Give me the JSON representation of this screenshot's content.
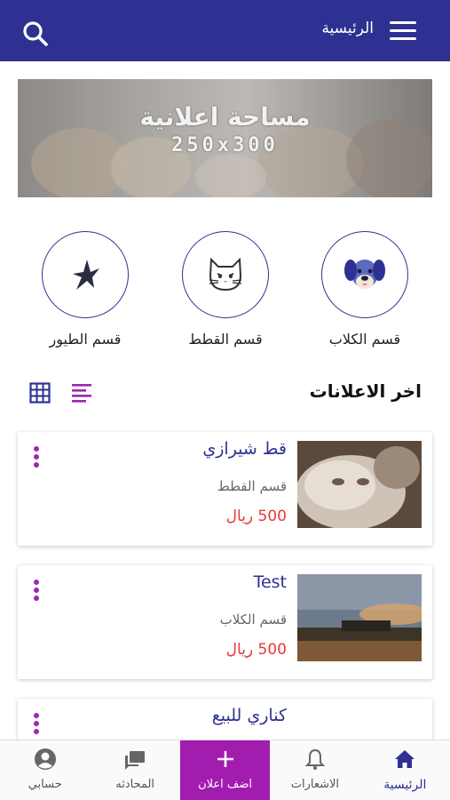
{
  "header": {
    "title": "الرئيسية"
  },
  "banner": {
    "line1": "مساحة اعلانية",
    "line2": "250x300"
  },
  "categories": [
    {
      "label": "قسم الكلاب",
      "icon": "dog-icon"
    },
    {
      "label": "قسم القطط",
      "icon": "cat-icon"
    },
    {
      "label": "قسم الطيور",
      "icon": "bird-icon"
    }
  ],
  "section": {
    "title": "اخر الاعلانات"
  },
  "ads": [
    {
      "title": "قط شيرازي",
      "category": "قسم القطط",
      "price": "500 ريال"
    },
    {
      "title": "Test",
      "category": "قسم الكلاب",
      "price": "500 ريال"
    },
    {
      "title": "كناري للبيع",
      "category": "",
      "price": ""
    }
  ],
  "bottom_nav": [
    {
      "label": "الرئيسية",
      "icon": "home-icon",
      "active": true
    },
    {
      "label": "الاشعارات",
      "icon": "bell-icon"
    },
    {
      "label": "اضف اعلان",
      "icon": "plus-icon"
    },
    {
      "label": "المحادثه",
      "icon": "chat-icon"
    },
    {
      "label": "حسابي",
      "icon": "account-icon"
    }
  ],
  "colors": {
    "primary": "#2e3192",
    "accent": "#a21caf",
    "price": "#e53935"
  }
}
